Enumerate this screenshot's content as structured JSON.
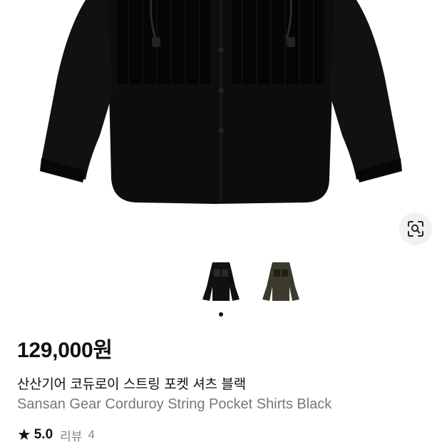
{
  "product": {
    "price": "129,000원",
    "title_ko": "산산기어 코듀로이 스트링 포켓 셔츠 블랙",
    "title_en": "Sansan Gear Corduroy String Pocket Shirts Black"
  },
  "rating": {
    "star_icon": "★",
    "score": "5.0",
    "review_label": "리뷰",
    "review_count": "4"
  },
  "gallery": {
    "thumbnails": [
      "black",
      "olive"
    ],
    "active_index": 0,
    "colors": {
      "black": "#111111",
      "olive": "#3b3a2c"
    }
  },
  "icons": {
    "lens": "lens-search-icon",
    "star": "star-icon"
  }
}
